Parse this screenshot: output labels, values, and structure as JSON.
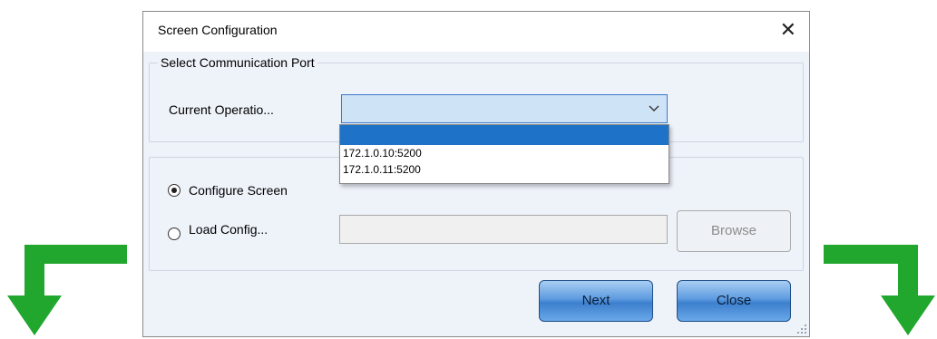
{
  "dialog": {
    "title": "Screen Configuration",
    "close_glyph": "✕"
  },
  "port_group": {
    "legend": "Select Communication Port",
    "operation_label": "Current Operatio...",
    "combo_value": "",
    "dropdown_options": [
      "",
      "172.1.0.10:5200",
      "172.1.0.11:5200"
    ]
  },
  "config_group": {
    "configure_label": "Configure Screen",
    "load_label": "Load Config...",
    "path_value": "",
    "browse_label": "Browse"
  },
  "buttons": {
    "next_label": "Next",
    "close_label": "Close"
  },
  "colors": {
    "arrow": "#22a72e",
    "selection": "#1e73c8",
    "dialog_bg": "#eef2f9"
  }
}
